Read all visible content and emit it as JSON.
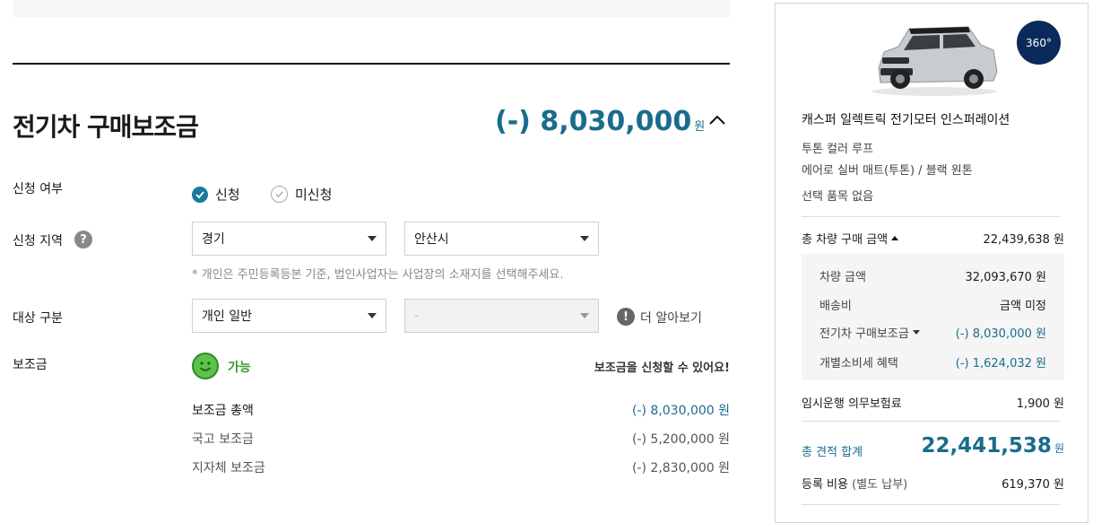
{
  "section": {
    "title": "전기차 구매보조금",
    "amount": "(-) 8,030,000",
    "unit": "원"
  },
  "apply": {
    "label": "신청 여부",
    "option_yes": "신청",
    "option_no": "미신청",
    "selected": "신청"
  },
  "region": {
    "label": "신청 지역",
    "help_glyph": "?",
    "province": "경기",
    "city": "안산시",
    "note": "* 개인은 주민등록등본 기준, 법인사업자는 사업장의 소재지를 선택해주세요."
  },
  "target": {
    "label": "대상 구분",
    "type": "개인 일반",
    "sub": "-",
    "info_glyph": "!",
    "learn_more": "더 알아보기"
  },
  "subsidy": {
    "label": "보조금",
    "status": "가능",
    "message": "보조금을 신청할 수 있어요!",
    "rows": [
      {
        "label": "보조금 총액",
        "value": "(-) 8,030,000 원"
      },
      {
        "label": "국고 보조금",
        "value": "(-) 5,200,000 원"
      },
      {
        "label": "지자체 보조금",
        "value": "(-) 2,830,000 원"
      }
    ]
  },
  "summary": {
    "badge": "360°",
    "car_name": "캐스퍼 일렉트릭 전기모터 인스퍼레이션",
    "option1": "투톤 컬러 루프",
    "option2": "에어로 실버 매트(투톤) / 블랙 원톤",
    "option3": "선택 품목 없음",
    "total_purchase_label": "총 차량 구매 금액",
    "total_purchase_value": "22,439,638 원",
    "breakdown": [
      {
        "label": "차량 금액",
        "value": "32,093,670 원"
      },
      {
        "label": "배송비",
        "value": "금액 미정"
      },
      {
        "label": "전기차 구매보조금",
        "value": "(-) 8,030,000 원"
      },
      {
        "label": "개별소비세 혜택",
        "value": "(-) 1,624,032 원"
      }
    ],
    "insurance_label": "임시운행 의무보험료",
    "insurance_value": "1,900 원",
    "estimate_label": "총 견적 합계",
    "estimate_value": "22,441,538",
    "estimate_unit": "원",
    "reg_label": "등록 비용",
    "reg_sub": "(별도 납부)",
    "reg_value": "619,370 원"
  },
  "colors": {
    "accent": "#1a6c8c",
    "success": "#5cc24a",
    "badge_bg": "#0b2a5b"
  }
}
